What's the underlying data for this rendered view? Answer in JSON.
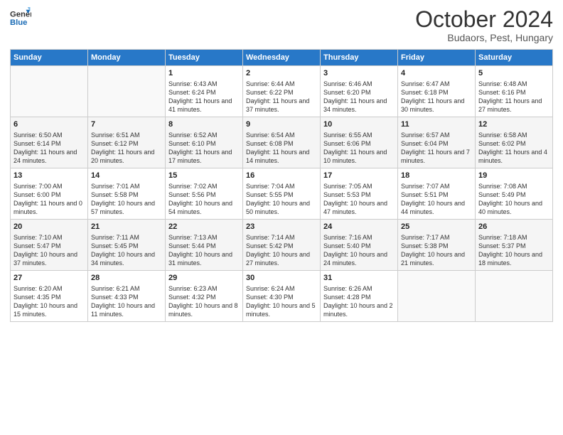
{
  "logo": {
    "line1": "General",
    "line2": "Blue"
  },
  "title": "October 2024",
  "location": "Budaors, Pest, Hungary",
  "days_of_week": [
    "Sunday",
    "Monday",
    "Tuesday",
    "Wednesday",
    "Thursday",
    "Friday",
    "Saturday"
  ],
  "weeks": [
    [
      {
        "day": "",
        "sunrise": "",
        "sunset": "",
        "daylight": ""
      },
      {
        "day": "",
        "sunrise": "",
        "sunset": "",
        "daylight": ""
      },
      {
        "day": "1",
        "sunrise": "Sunrise: 6:43 AM",
        "sunset": "Sunset: 6:24 PM",
        "daylight": "Daylight: 11 hours and 41 minutes."
      },
      {
        "day": "2",
        "sunrise": "Sunrise: 6:44 AM",
        "sunset": "Sunset: 6:22 PM",
        "daylight": "Daylight: 11 hours and 37 minutes."
      },
      {
        "day": "3",
        "sunrise": "Sunrise: 6:46 AM",
        "sunset": "Sunset: 6:20 PM",
        "daylight": "Daylight: 11 hours and 34 minutes."
      },
      {
        "day": "4",
        "sunrise": "Sunrise: 6:47 AM",
        "sunset": "Sunset: 6:18 PM",
        "daylight": "Daylight: 11 hours and 30 minutes."
      },
      {
        "day": "5",
        "sunrise": "Sunrise: 6:48 AM",
        "sunset": "Sunset: 6:16 PM",
        "daylight": "Daylight: 11 hours and 27 minutes."
      }
    ],
    [
      {
        "day": "6",
        "sunrise": "Sunrise: 6:50 AM",
        "sunset": "Sunset: 6:14 PM",
        "daylight": "Daylight: 11 hours and 24 minutes."
      },
      {
        "day": "7",
        "sunrise": "Sunrise: 6:51 AM",
        "sunset": "Sunset: 6:12 PM",
        "daylight": "Daylight: 11 hours and 20 minutes."
      },
      {
        "day": "8",
        "sunrise": "Sunrise: 6:52 AM",
        "sunset": "Sunset: 6:10 PM",
        "daylight": "Daylight: 11 hours and 17 minutes."
      },
      {
        "day": "9",
        "sunrise": "Sunrise: 6:54 AM",
        "sunset": "Sunset: 6:08 PM",
        "daylight": "Daylight: 11 hours and 14 minutes."
      },
      {
        "day": "10",
        "sunrise": "Sunrise: 6:55 AM",
        "sunset": "Sunset: 6:06 PM",
        "daylight": "Daylight: 11 hours and 10 minutes."
      },
      {
        "day": "11",
        "sunrise": "Sunrise: 6:57 AM",
        "sunset": "Sunset: 6:04 PM",
        "daylight": "Daylight: 11 hours and 7 minutes."
      },
      {
        "day": "12",
        "sunrise": "Sunrise: 6:58 AM",
        "sunset": "Sunset: 6:02 PM",
        "daylight": "Daylight: 11 hours and 4 minutes."
      }
    ],
    [
      {
        "day": "13",
        "sunrise": "Sunrise: 7:00 AM",
        "sunset": "Sunset: 6:00 PM",
        "daylight": "Daylight: 11 hours and 0 minutes."
      },
      {
        "day": "14",
        "sunrise": "Sunrise: 7:01 AM",
        "sunset": "Sunset: 5:58 PM",
        "daylight": "Daylight: 10 hours and 57 minutes."
      },
      {
        "day": "15",
        "sunrise": "Sunrise: 7:02 AM",
        "sunset": "Sunset: 5:56 PM",
        "daylight": "Daylight: 10 hours and 54 minutes."
      },
      {
        "day": "16",
        "sunrise": "Sunrise: 7:04 AM",
        "sunset": "Sunset: 5:55 PM",
        "daylight": "Daylight: 10 hours and 50 minutes."
      },
      {
        "day": "17",
        "sunrise": "Sunrise: 7:05 AM",
        "sunset": "Sunset: 5:53 PM",
        "daylight": "Daylight: 10 hours and 47 minutes."
      },
      {
        "day": "18",
        "sunrise": "Sunrise: 7:07 AM",
        "sunset": "Sunset: 5:51 PM",
        "daylight": "Daylight: 10 hours and 44 minutes."
      },
      {
        "day": "19",
        "sunrise": "Sunrise: 7:08 AM",
        "sunset": "Sunset: 5:49 PM",
        "daylight": "Daylight: 10 hours and 40 minutes."
      }
    ],
    [
      {
        "day": "20",
        "sunrise": "Sunrise: 7:10 AM",
        "sunset": "Sunset: 5:47 PM",
        "daylight": "Daylight: 10 hours and 37 minutes."
      },
      {
        "day": "21",
        "sunrise": "Sunrise: 7:11 AM",
        "sunset": "Sunset: 5:45 PM",
        "daylight": "Daylight: 10 hours and 34 minutes."
      },
      {
        "day": "22",
        "sunrise": "Sunrise: 7:13 AM",
        "sunset": "Sunset: 5:44 PM",
        "daylight": "Daylight: 10 hours and 31 minutes."
      },
      {
        "day": "23",
        "sunrise": "Sunrise: 7:14 AM",
        "sunset": "Sunset: 5:42 PM",
        "daylight": "Daylight: 10 hours and 27 minutes."
      },
      {
        "day": "24",
        "sunrise": "Sunrise: 7:16 AM",
        "sunset": "Sunset: 5:40 PM",
        "daylight": "Daylight: 10 hours and 24 minutes."
      },
      {
        "day": "25",
        "sunrise": "Sunrise: 7:17 AM",
        "sunset": "Sunset: 5:38 PM",
        "daylight": "Daylight: 10 hours and 21 minutes."
      },
      {
        "day": "26",
        "sunrise": "Sunrise: 7:18 AM",
        "sunset": "Sunset: 5:37 PM",
        "daylight": "Daylight: 10 hours and 18 minutes."
      }
    ],
    [
      {
        "day": "27",
        "sunrise": "Sunrise: 6:20 AM",
        "sunset": "Sunset: 4:35 PM",
        "daylight": "Daylight: 10 hours and 15 minutes."
      },
      {
        "day": "28",
        "sunrise": "Sunrise: 6:21 AM",
        "sunset": "Sunset: 4:33 PM",
        "daylight": "Daylight: 10 hours and 11 minutes."
      },
      {
        "day": "29",
        "sunrise": "Sunrise: 6:23 AM",
        "sunset": "Sunset: 4:32 PM",
        "daylight": "Daylight: 10 hours and 8 minutes."
      },
      {
        "day": "30",
        "sunrise": "Sunrise: 6:24 AM",
        "sunset": "Sunset: 4:30 PM",
        "daylight": "Daylight: 10 hours and 5 minutes."
      },
      {
        "day": "31",
        "sunrise": "Sunrise: 6:26 AM",
        "sunset": "Sunset: 4:28 PM",
        "daylight": "Daylight: 10 hours and 2 minutes."
      },
      {
        "day": "",
        "sunrise": "",
        "sunset": "",
        "daylight": ""
      },
      {
        "day": "",
        "sunrise": "",
        "sunset": "",
        "daylight": ""
      }
    ]
  ]
}
